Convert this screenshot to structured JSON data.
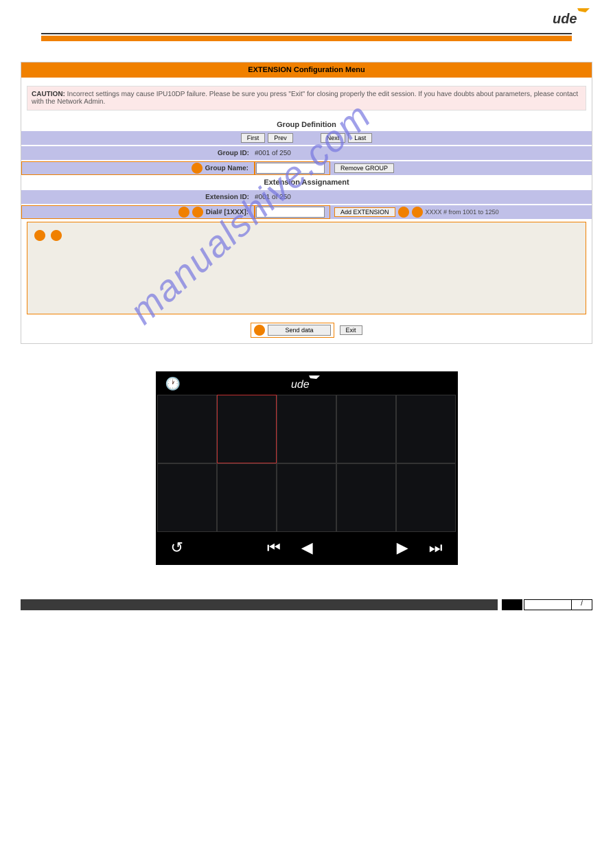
{
  "logo_text": "ude",
  "menu_title": "EXTENSION Configuration Menu",
  "caution": {
    "label": "CAUTION:",
    "text": "Incorrect settings may cause IPU10DP failure. Please be sure you press \"Exit\" for closing properly the edit session. If you have doubts about parameters, please contact with the Network Admin."
  },
  "group_def": {
    "title": "Group Definition",
    "nav": {
      "first": "First",
      "prev": "Prev",
      "next": "Next",
      "last": "Last"
    },
    "id_label": "Group ID:",
    "id_value": "#001 of 250",
    "name_label": "Group Name:",
    "remove_btn": "Remove GROUP"
  },
  "ext_assign": {
    "title": "Extension Assignament",
    "id_label": "Extension ID:",
    "id_value": "#001 of 250",
    "dial_label": "Dial# [1XXX]:",
    "add_btn": "Add EXTENSION",
    "hint": "XXXX # from 1001 to 1250"
  },
  "bottom": {
    "send": "Send data",
    "exit": "Exit"
  },
  "watermark": "manualshive.com",
  "device": {
    "logo": "ude"
  }
}
